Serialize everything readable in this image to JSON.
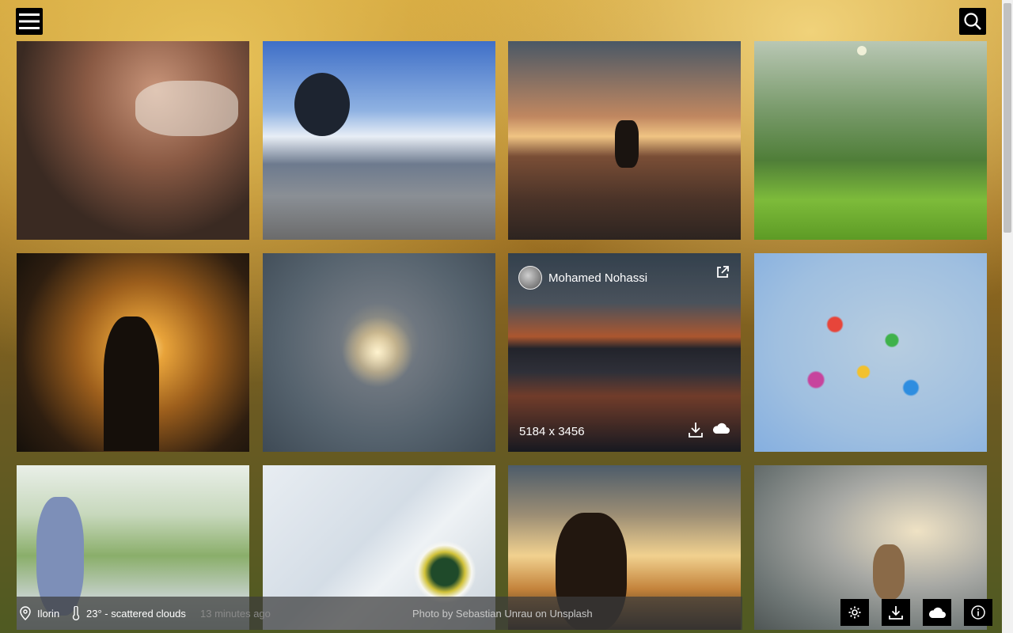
{
  "header": {
    "menu_icon": "hamburger-icon",
    "search_icon": "search-icon"
  },
  "active_tile": {
    "author": "Mohamed Nohassi",
    "dimensions": "5184 x 3456"
  },
  "footer": {
    "location": "Ilorin",
    "weather": "23° - scattered clouds",
    "updated": "13 minutes ago",
    "credit": "Photo by Sebastian Unrau on Unsplash"
  },
  "colors": {
    "overlay": "#3c3c3c",
    "button_bg": "#000000",
    "text": "#ffffff",
    "muted": "#8a8a8a"
  }
}
